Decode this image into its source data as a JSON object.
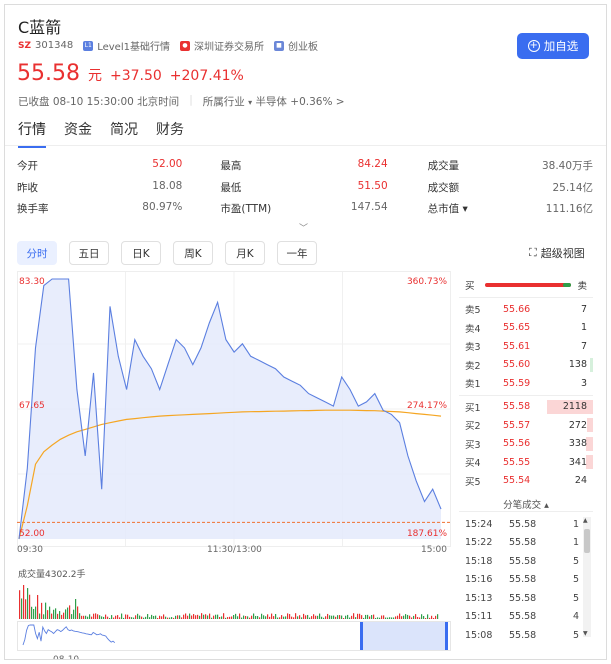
{
  "stock": {
    "name": "C蓝箭",
    "exchange_badge": "SZ",
    "code": "301348",
    "level": "Level1基础行情",
    "market": "深圳证券交易所",
    "board": "创业板"
  },
  "quote": {
    "price": "55.58",
    "unit": "元",
    "change": "+37.50",
    "change_pct": "+207.41%",
    "status": "已收盘 08-10 15:30:00 北京时间",
    "industry_label": "所属行业",
    "industry_name": "半导体 +0.36%",
    "industry_arrow": ">"
  },
  "add_button": "加自选",
  "tabs": [
    "行情",
    "资金",
    "简况",
    "财务"
  ],
  "stats": [
    [
      {
        "k": "今开",
        "v": "52.00",
        "c": "red"
      },
      {
        "k": "最高",
        "v": "84.24",
        "c": "red"
      },
      {
        "k": "成交量",
        "v": "38.40万手",
        "c": "gray"
      }
    ],
    [
      {
        "k": "昨收",
        "v": "18.08",
        "c": "gray"
      },
      {
        "k": "最低",
        "v": "51.50",
        "c": "red"
      },
      {
        "k": "成交额",
        "v": "25.14亿",
        "c": "gray"
      }
    ],
    [
      {
        "k": "换手率",
        "v": "80.97%",
        "c": "gray"
      },
      {
        "k": "市盈(TTM)",
        "v": "147.54",
        "c": "gray"
      },
      {
        "k": "总市值 ▾",
        "v": "111.16亿",
        "c": "gray"
      }
    ]
  ],
  "periods": [
    "分时",
    "五日",
    "日K",
    "周K",
    "月K",
    "一年"
  ],
  "super_view": "超级视图",
  "chart_data": {
    "type": "line",
    "y_left": [
      "83.30",
      "67.65",
      "52.00"
    ],
    "y_right": [
      "360.73%",
      "274.17%",
      "187.61%"
    ],
    "x_labels": [
      "09:30",
      "11:30/13:00",
      "15:00"
    ],
    "ylim": [
      52.0,
      83.3
    ],
    "prev_close_line": 54.0,
    "price": [
      52.0,
      60.5,
      75.0,
      82.5,
      83.3,
      83.3,
      83.3,
      70.0,
      62.0,
      72.0,
      58.0,
      80.0,
      74.0,
      70.0,
      76.0,
      74.0,
      72.5,
      70.0,
      73.0,
      76.0,
      75.0,
      73.0,
      75.0,
      78.0,
      80.5,
      76.0,
      74.5,
      75.5,
      74.0,
      73.5,
      73.0,
      72.5,
      71.5,
      71.0,
      70.5,
      69.5,
      69.0,
      68.5,
      68.0,
      71.5,
      70.0,
      68.0,
      68.5,
      69.5,
      67.5,
      67.0,
      66.0,
      62.0,
      59.0,
      56.5,
      58.0,
      55.6
    ],
    "avg": [
      52.0,
      56.0,
      61.0,
      62.5,
      63.3,
      64.0,
      64.5,
      64.9,
      65.2,
      65.5,
      65.8,
      66.0,
      66.2,
      66.4,
      66.5,
      66.6,
      66.7,
      66.8,
      66.85,
      66.9,
      66.95,
      67.0,
      67.05,
      67.1,
      67.15,
      67.2,
      67.25,
      67.3,
      67.32,
      67.34,
      67.36,
      67.38,
      67.4,
      67.42,
      67.44,
      67.46,
      67.48,
      67.5,
      67.5,
      67.5,
      67.5,
      67.48,
      67.46,
      67.44,
      67.4,
      67.35,
      67.3,
      67.2,
      67.1,
      67.0,
      66.9,
      66.8
    ],
    "volume_label": "成交量4302.2手",
    "mini_date": "08-10"
  },
  "orderbook": {
    "header_buy": "买",
    "header_sell": "卖",
    "asks": [
      {
        "label": "卖5",
        "price": "55.66",
        "vol": "7",
        "bar": 0.0
      },
      {
        "label": "卖4",
        "price": "55.65",
        "vol": "1",
        "bar": 0.0
      },
      {
        "label": "卖3",
        "price": "55.61",
        "vol": "7",
        "bar": 0.0
      },
      {
        "label": "卖2",
        "price": "55.60",
        "vol": "138",
        "bar": 0.06
      },
      {
        "label": "卖1",
        "price": "55.59",
        "vol": "3",
        "bar": 0.0
      }
    ],
    "bids": [
      {
        "label": "买1",
        "price": "55.58",
        "vol": "2118",
        "bar": 0.95
      },
      {
        "label": "买2",
        "price": "55.57",
        "vol": "272",
        "bar": 0.12
      },
      {
        "label": "买3",
        "price": "55.56",
        "vol": "338",
        "bar": 0.15
      },
      {
        "label": "买4",
        "price": "55.55",
        "vol": "341",
        "bar": 0.15
      },
      {
        "label": "买5",
        "price": "55.54",
        "vol": "24",
        "bar": 0.0
      }
    ]
  },
  "trades_title": "分笔成交 ▴",
  "trades": [
    {
      "t": "15:24",
      "p": "55.58",
      "v": "1"
    },
    {
      "t": "15:22",
      "p": "55.58",
      "v": "1"
    },
    {
      "t": "15:18",
      "p": "55.58",
      "v": "5"
    },
    {
      "t": "15:16",
      "p": "55.58",
      "v": "5"
    },
    {
      "t": "15:13",
      "p": "55.58",
      "v": "5"
    },
    {
      "t": "15:11",
      "p": "55.58",
      "v": "4"
    },
    {
      "t": "15:08",
      "p": "55.58",
      "v": "5"
    }
  ],
  "colors": {
    "accent": "#3a6df0",
    "up": "#e93030",
    "down": "#2e9e4a",
    "avg_line": "#f5a623",
    "price_line": "#5b7fe0"
  }
}
